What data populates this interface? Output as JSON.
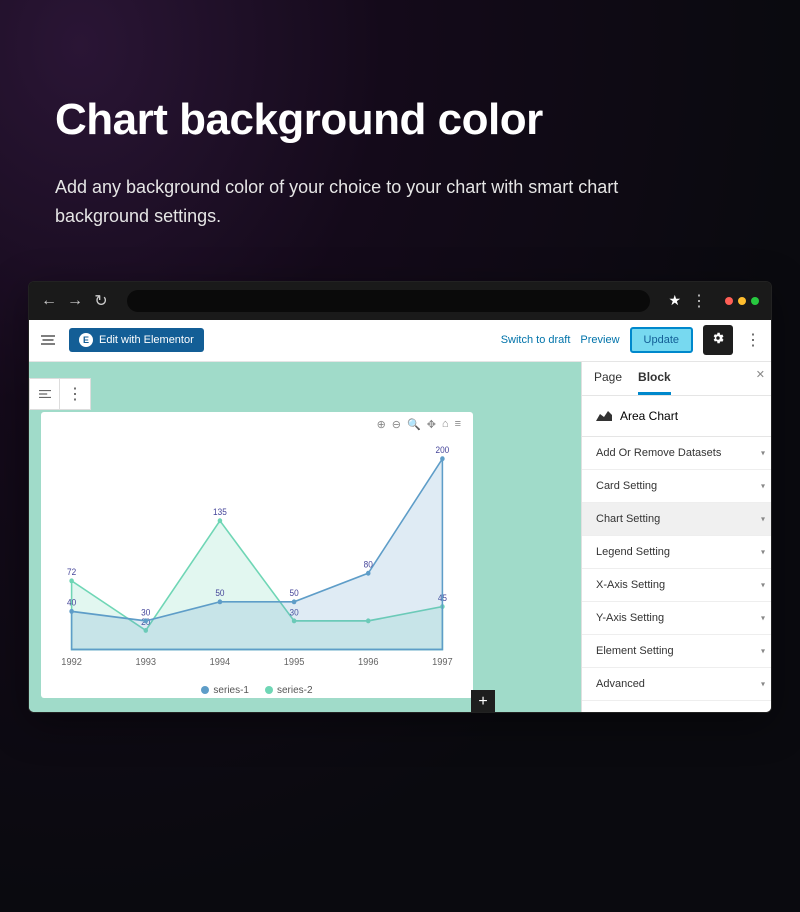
{
  "hero": {
    "title": "Chart background color",
    "desc": "Add any background color of your choice to your chart with smart chart background settings."
  },
  "editor": {
    "elementor_label": "Edit with Elementor",
    "switch_draft_label": "Switch to draft",
    "preview_label": "Preview",
    "update_label": "Update"
  },
  "inspector": {
    "tabs": {
      "page": "Page",
      "block": "Block"
    },
    "block_title": "Area Chart",
    "panels": [
      "Add Or Remove Datasets",
      "Card Setting",
      "Chart Setting",
      "Legend Setting",
      "X-Axis Setting",
      "Y-Axis Setting",
      "Element Setting",
      "Advanced"
    ],
    "active_panel": "Chart Setting"
  },
  "legend": {
    "s1": "series-1",
    "s2": "series-2"
  },
  "chart_data": {
    "type": "area",
    "categories": [
      "1992",
      "1993",
      "1994",
      "1995",
      "1996",
      "1997"
    ],
    "series": [
      {
        "name": "series-1",
        "color": "#5e9dc8",
        "values": [
          40,
          30,
          50,
          50,
          80,
          200
        ],
        "labels": [
          "40",
          "30",
          "50",
          "50",
          "80",
          "200"
        ]
      },
      {
        "name": "series-2",
        "color": "#6fd6b5",
        "values": [
          72,
          20,
          135,
          30,
          30,
          45
        ],
        "labels": [
          "72",
          "20",
          "135",
          "30",
          "",
          "45"
        ]
      }
    ],
    "ylim": [
      0,
      210
    ],
    "title": "",
    "xlabel": "",
    "ylabel": ""
  },
  "colors": {
    "canvas": "#a0dbc9",
    "accent_blue": "#0088cc",
    "toolbar_blue": "#135e96"
  }
}
